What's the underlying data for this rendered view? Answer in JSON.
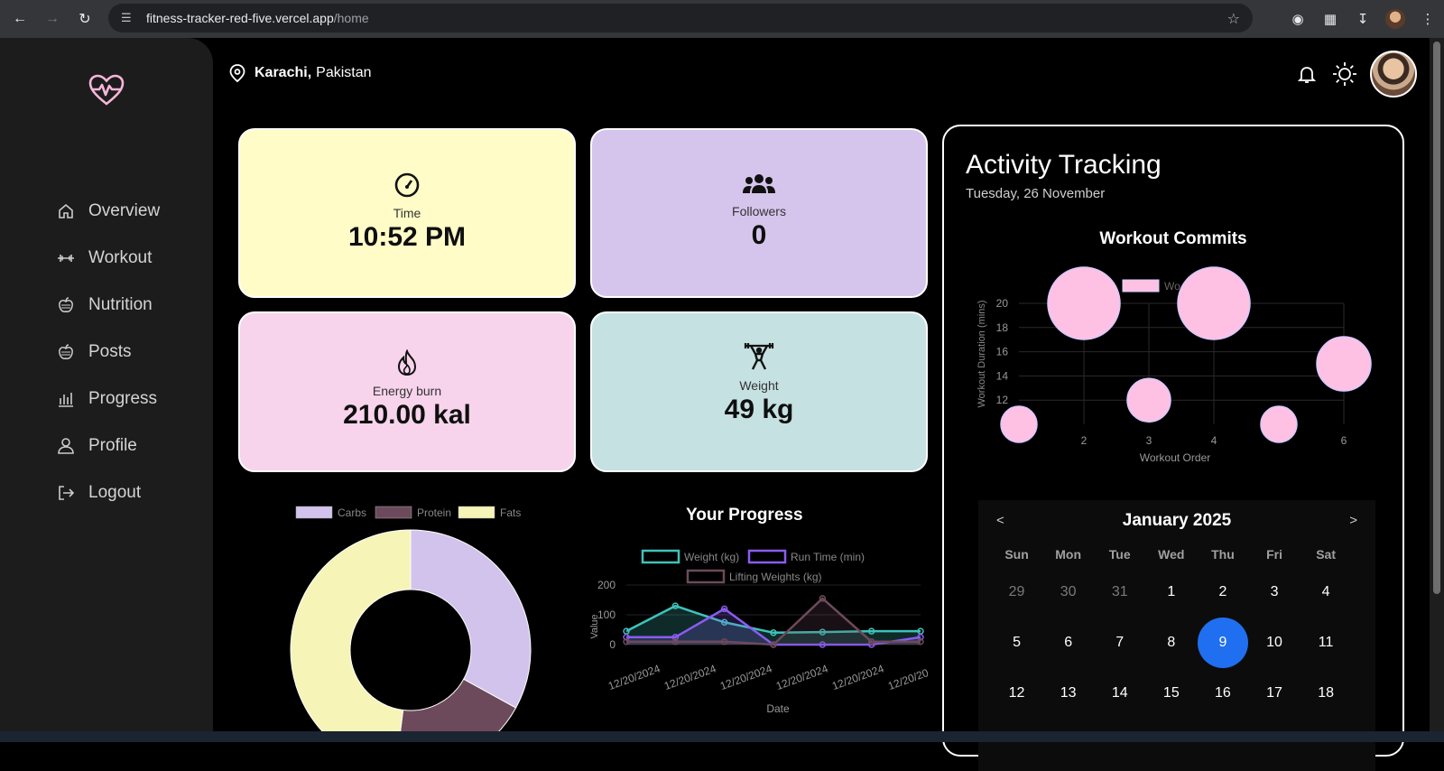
{
  "browser": {
    "url_host": "fitness-tracker-red-five.vercel.app",
    "url_path": "/home"
  },
  "sidebar": {
    "items": [
      {
        "label": "Overview",
        "icon": "home-icon"
      },
      {
        "label": "Workout",
        "icon": "dumbbell-icon"
      },
      {
        "label": "Nutrition",
        "icon": "apple-icon"
      },
      {
        "label": "Posts",
        "icon": "apple-icon"
      },
      {
        "label": "Progress",
        "icon": "bar-chart-icon"
      },
      {
        "label": "Profile",
        "icon": "user-icon"
      },
      {
        "label": "Logout",
        "icon": "logout-icon"
      }
    ]
  },
  "header": {
    "city": "Karachi,",
    "country": "Pakistan"
  },
  "cards": {
    "time": {
      "label": "Time",
      "value": "10:52 PM"
    },
    "followers": {
      "label": "Followers",
      "value": "0"
    },
    "energy": {
      "label": "Energy burn",
      "value": "210.00 kal"
    },
    "weight": {
      "label": "Weight",
      "value": "49 kg"
    }
  },
  "activity": {
    "title": "Activity Tracking",
    "date": "Tuesday, 26 November",
    "commits_title": "Workout Commits"
  },
  "calendar": {
    "month": "January 2025",
    "prev": "<",
    "next": ">",
    "weekdays": [
      "Sun",
      "Mon",
      "Tue",
      "Wed",
      "Thu",
      "Fri",
      "Sat"
    ],
    "days": [
      "29",
      "30",
      "31",
      "1",
      "2",
      "3",
      "4",
      "5",
      "6",
      "7",
      "8",
      "9",
      "10",
      "11",
      "12",
      "13",
      "14",
      "15",
      "16",
      "17",
      "18"
    ],
    "selected": "9"
  },
  "progress": {
    "title": "Your Progress"
  },
  "colors": {
    "time_card": "#fffcc7",
    "followers_card": "#d5c5ec",
    "energy_card": "#f7d4ec",
    "weight_card": "#c5e1e1",
    "bubble": "#ffc1e3",
    "selected_day": "#1f6ff0"
  },
  "chart_data": [
    {
      "type": "scatter",
      "title": "",
      "xlabel": "Workout Order",
      "ylabel": "Workout Duration (mins)",
      "legend": [
        "Wo"
      ],
      "x_ticks": [
        "2",
        "3",
        "4",
        "6"
      ],
      "y_ticks": [
        "12",
        "14",
        "16",
        "18",
        "20"
      ],
      "xlim": [
        1,
        6
      ],
      "ylim": [
        10,
        20
      ],
      "series": [
        {
          "name": "Wo",
          "points": [
            {
              "x": 1,
              "y": 10,
              "r": 20
            },
            {
              "x": 2,
              "y": 20,
              "r": 40
            },
            {
              "x": 3,
              "y": 12,
              "r": 24
            },
            {
              "x": 4,
              "y": 20,
              "r": 40
            },
            {
              "x": 5,
              "y": 10,
              "r": 20
            },
            {
              "x": 6,
              "y": 15,
              "r": 30
            }
          ]
        }
      ]
    },
    {
      "type": "pie",
      "donut": true,
      "legend": [
        "Carbs",
        "Protein",
        "Fats"
      ],
      "values": [
        33,
        19,
        48
      ],
      "colors": [
        "#d2c3ec",
        "#6d4a5b",
        "#f6f4b6"
      ]
    },
    {
      "type": "line",
      "title": "Your Progress",
      "xlabel": "Date",
      "ylabel": "Value",
      "categories": [
        "12/20/2024",
        "12/20/2024",
        "12/20/2024",
        "12/20/2024",
        "12/20/2024",
        "12/20/2024"
      ],
      "y_ticks": [
        "0",
        "100",
        "200"
      ],
      "ylim": [
        0,
        200
      ],
      "series": [
        {
          "name": "Weight (kg)",
          "color": "#3ec3bb",
          "values": [
            45,
            130,
            75,
            40,
            42,
            45,
            45
          ]
        },
        {
          "name": "Run Time (min)",
          "color": "#8a5cf0",
          "values": [
            25,
            25,
            120,
            0,
            0,
            0,
            25
          ]
        },
        {
          "name": "Lifting Weights (kg)",
          "color": "#6d4a5b",
          "values": [
            10,
            10,
            10,
            0,
            155,
            10,
            10
          ]
        }
      ]
    }
  ]
}
